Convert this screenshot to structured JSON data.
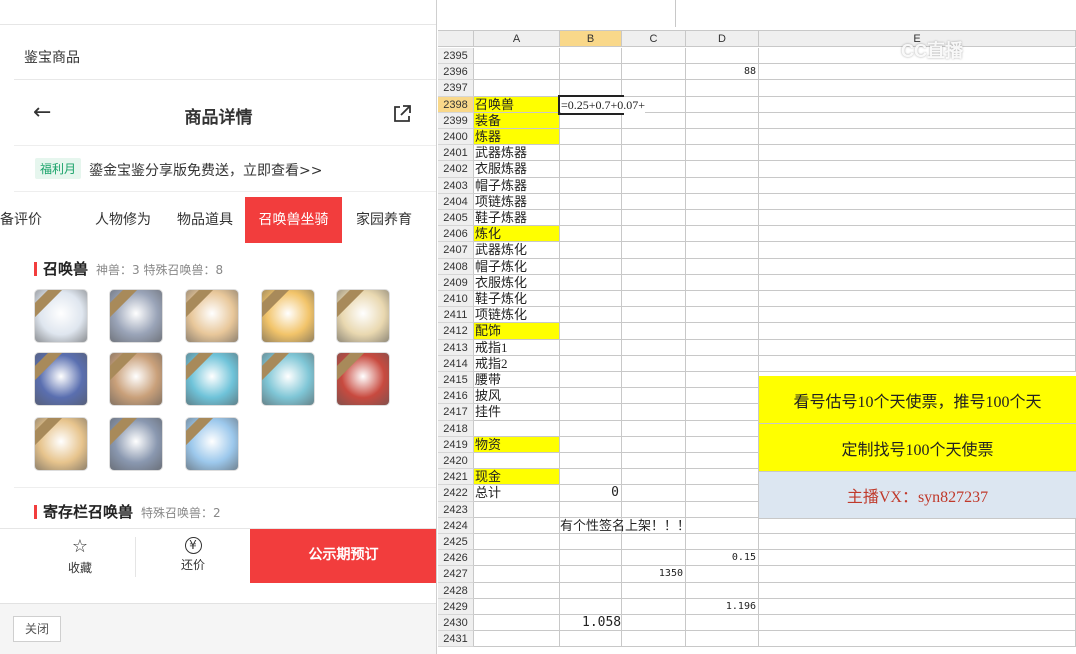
{
  "left": {
    "page_title": "鉴宝商品",
    "nav": {
      "title": "商品详情",
      "back_icon": "arrow-left-icon",
      "share_icon": "share-icon"
    },
    "promo": {
      "badge": "福利月",
      "text": "鎏金宝鉴分享版免费送，立即查看>>"
    },
    "tabs": [
      "备评价",
      "人物修为",
      "物品道具",
      "召唤兽坐骑",
      "家园养育"
    ],
    "active_tab": "召唤兽坐骑",
    "pets_section": {
      "title": "召唤兽",
      "sub": "神兽：3   特殊召唤兽：8"
    },
    "pets": [
      {
        "name": "panda",
        "color": "#dfe6ef"
      },
      {
        "name": "beast",
        "color": "#9aa4b8"
      },
      {
        "name": "elder",
        "color": "#e8c79a"
      },
      {
        "name": "girl",
        "color": "#f2c46a"
      },
      {
        "name": "dragon",
        "color": "#e9d8b0"
      },
      {
        "name": "blue-ghost",
        "color": "#5a6fb0"
      },
      {
        "name": "boar",
        "color": "#c9a07a"
      },
      {
        "name": "fairy",
        "color": "#6fc3d9"
      },
      {
        "name": "princess",
        "color": "#7fc6d6"
      },
      {
        "name": "panda-red",
        "color": "#c84a3f"
      },
      {
        "name": "fox",
        "color": "#e7c48d"
      },
      {
        "name": "troll",
        "color": "#8a98b0"
      },
      {
        "name": "crystal",
        "color": "#9cc8ec"
      }
    ],
    "storage_section": {
      "title": "寄存栏召唤兽",
      "sub": "特殊召唤兽：2"
    },
    "bottom": {
      "favorite": "收藏",
      "bargain": "还价",
      "preorder": "公示期预订",
      "favorite_icon": "star-icon",
      "bargain_icon": "yen-icon"
    },
    "close_label": "关闭"
  },
  "sheet": {
    "columns": [
      "A",
      "B",
      "C",
      "D",
      "E"
    ],
    "selected_column": "B",
    "rows": [
      {
        "n": "2395",
        "a": "",
        "b": "",
        "c": "",
        "d": "",
        "hl": false
      },
      {
        "n": "2396",
        "a": "",
        "b": "",
        "c": "",
        "d": "88",
        "hl": false
      },
      {
        "n": "2397",
        "a": "",
        "b": "",
        "c": "",
        "d": "",
        "hl": false
      },
      {
        "n": "2398",
        "a": "召唤兽",
        "b": "=0.25+0.7+0.07+",
        "c": "",
        "d": "",
        "hl": true
      },
      {
        "n": "2399",
        "a": "装备",
        "b": "",
        "c": "",
        "d": "",
        "hl": true
      },
      {
        "n": "2400",
        "a": "炼器",
        "b": "",
        "c": "",
        "d": "",
        "hl": true
      },
      {
        "n": "2401",
        "a": "武器炼器",
        "b": "",
        "c": "",
        "d": "",
        "hl": false
      },
      {
        "n": "2402",
        "a": "衣服炼器",
        "b": "",
        "c": "",
        "d": "",
        "hl": false
      },
      {
        "n": "2403",
        "a": "帽子炼器",
        "b": "",
        "c": "",
        "d": "",
        "hl": false
      },
      {
        "n": "2404",
        "a": "项链炼器",
        "b": "",
        "c": "",
        "d": "",
        "hl": false
      },
      {
        "n": "2405",
        "a": "鞋子炼器",
        "b": "",
        "c": "",
        "d": "",
        "hl": false
      },
      {
        "n": "2406",
        "a": "炼化",
        "b": "",
        "c": "",
        "d": "",
        "hl": true
      },
      {
        "n": "2407",
        "a": "武器炼化",
        "b": "",
        "c": "",
        "d": "",
        "hl": false
      },
      {
        "n": "2408",
        "a": "帽子炼化",
        "b": "",
        "c": "",
        "d": "",
        "hl": false
      },
      {
        "n": "2409",
        "a": "衣服炼化",
        "b": "",
        "c": "",
        "d": "",
        "hl": false
      },
      {
        "n": "2410",
        "a": "鞋子炼化",
        "b": "",
        "c": "",
        "d": "",
        "hl": false
      },
      {
        "n": "2411",
        "a": "项链炼化",
        "b": "",
        "c": "",
        "d": "",
        "hl": false
      },
      {
        "n": "2412",
        "a": "配饰",
        "b": "",
        "c": "",
        "d": "",
        "hl": true
      },
      {
        "n": "2413",
        "a": "戒指1",
        "b": "",
        "c": "",
        "d": "",
        "hl": false
      },
      {
        "n": "2414",
        "a": "戒指2",
        "b": "",
        "c": "",
        "d": "",
        "hl": false
      },
      {
        "n": "2415",
        "a": "腰带",
        "b": "",
        "c": "",
        "d": "",
        "hl": false
      },
      {
        "n": "2416",
        "a": "披风",
        "b": "",
        "c": "",
        "d": "",
        "hl": false
      },
      {
        "n": "2417",
        "a": "挂件",
        "b": "",
        "c": "",
        "d": "",
        "hl": false
      },
      {
        "n": "2418",
        "a": "",
        "b": "",
        "c": "",
        "d": "",
        "hl": false
      },
      {
        "n": "2419",
        "a": "物资",
        "b": "",
        "c": "",
        "d": "",
        "hl": true
      },
      {
        "n": "2420",
        "a": "",
        "b": "",
        "c": "",
        "d": "",
        "hl": false
      },
      {
        "n": "2421",
        "a": "现金",
        "b": "",
        "c": "",
        "d": "",
        "hl": true
      },
      {
        "n": "2422",
        "a": "总计",
        "b": "0",
        "c": "",
        "d": "",
        "hl": false
      },
      {
        "n": "2423",
        "a": "",
        "b": "",
        "c": "",
        "d": "",
        "hl": false
      },
      {
        "n": "2424",
        "a": "",
        "b": "有个性签名上架！！！",
        "c": "",
        "d": "",
        "hl": false
      },
      {
        "n": "2425",
        "a": "",
        "b": "",
        "c": "",
        "d": "",
        "hl": false
      },
      {
        "n": "2426",
        "a": "",
        "b": "",
        "c": "",
        "d": "0.15",
        "hl": false
      },
      {
        "n": "2427",
        "a": "",
        "b": "",
        "c": "1350",
        "d": "",
        "hl": false
      },
      {
        "n": "2428",
        "a": "",
        "b": "",
        "c": "",
        "d": "",
        "hl": false
      },
      {
        "n": "2429",
        "a": "",
        "b": "",
        "c": "",
        "d": "1.196",
        "hl": false
      },
      {
        "n": "2430",
        "a": "",
        "b": "1.058",
        "c": "",
        "d": "",
        "hl": false
      },
      {
        "n": "2431",
        "a": "",
        "b": "",
        "c": "",
        "d": "",
        "hl": false
      }
    ],
    "banners": {
      "b1": "看号估号10个天使票，推号100个天",
      "b2": "定制找号100个天使票",
      "b3": "主播VX：syn827237"
    },
    "colors": {
      "yellow": "#ffff00",
      "banner_blue": "#dce6f1",
      "banner_text": "#c0392b"
    },
    "watermark": "CC直播"
  }
}
